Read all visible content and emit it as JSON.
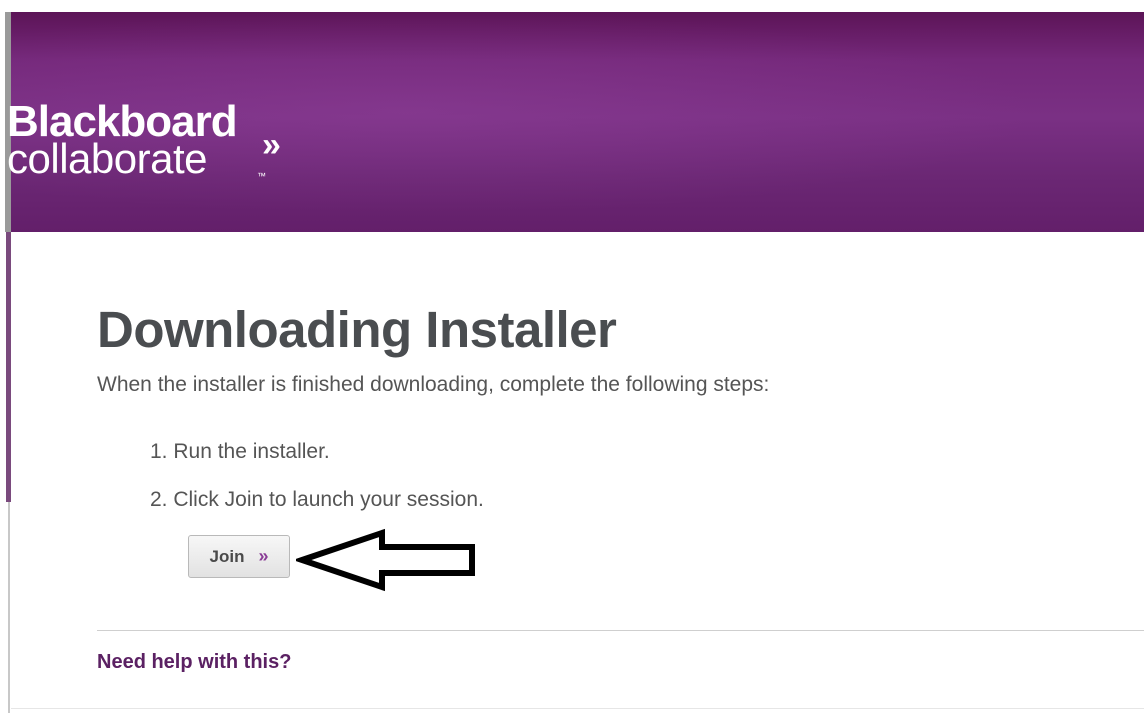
{
  "brand": {
    "line1": "Blackboard",
    "line2": "collaborate",
    "chevron": "»",
    "trademark": "™",
    "header_color": "#74287a"
  },
  "main": {
    "title": "Downloading Installer",
    "intro": "When the installer is finished downloading, complete the following steps:",
    "steps": [
      "1. Run the installer.",
      "2. Click Join to launch your session."
    ],
    "join_label": "Join",
    "join_icon": "double-chevron-right-icon",
    "join_chevron": "»",
    "help_link": "Need help with this?"
  },
  "annotation": {
    "icon": "left-arrow-icon"
  }
}
